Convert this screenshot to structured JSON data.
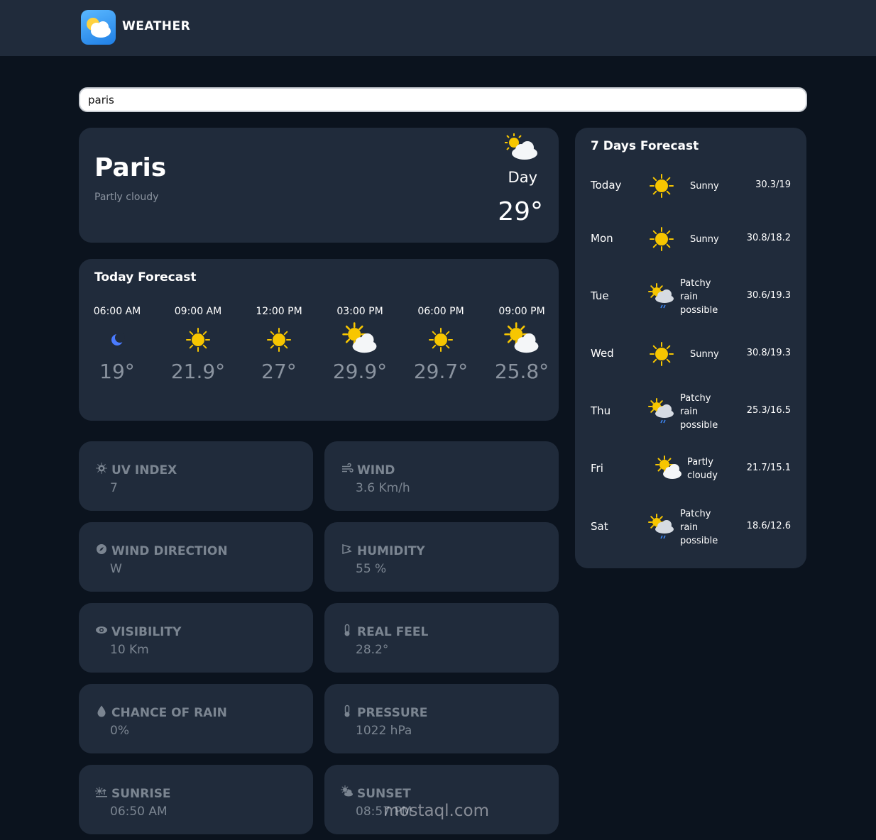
{
  "app": {
    "brand": "WEATHER"
  },
  "search": {
    "value": "paris"
  },
  "current": {
    "city": "Paris",
    "condition": "Partly cloudy",
    "period": "Day",
    "temperature": "29°",
    "icon": "sun-cloud-icon"
  },
  "today_forecast": {
    "title": "Today Forecast",
    "hours": [
      {
        "time": "06:00 AM",
        "temp": "19°",
        "icon": "moon-icon"
      },
      {
        "time": "09:00 AM",
        "temp": "21.9°",
        "icon": "sun-icon"
      },
      {
        "time": "12:00 PM",
        "temp": "27°",
        "icon": "sun-icon"
      },
      {
        "time": "03:00 PM",
        "temp": "29.9°",
        "icon": "sun-cloud-icon"
      },
      {
        "time": "06:00 PM",
        "temp": "29.7°",
        "icon": "sun-icon"
      },
      {
        "time": "09:00 PM",
        "temp": "25.8°",
        "icon": "sun-cloud-icon"
      }
    ]
  },
  "stats": [
    {
      "label": "UV INDEX",
      "value": "7",
      "icon": "sun-gear-icon"
    },
    {
      "label": "WIND",
      "value": "3.6 Km/h",
      "icon": "wind-icon"
    },
    {
      "label": "WIND DIRECTION",
      "value": "W",
      "icon": "compass-icon"
    },
    {
      "label": "HUMIDITY",
      "value": "55 %",
      "icon": "humidity-icon"
    },
    {
      "label": "VISIBILITY",
      "value": "10 Km",
      "icon": "eye-icon"
    },
    {
      "label": "REAL FEEL",
      "value": "28.2°",
      "icon": "thermometer-icon"
    },
    {
      "label": "CHANCE OF RAIN",
      "value": "0%",
      "icon": "droplet-icon"
    },
    {
      "label": "PRESSURE",
      "value": "1022 hPa",
      "icon": "thermometer-icon"
    },
    {
      "label": "SUNRISE",
      "value": "06:50 AM",
      "icon": "sunrise-icon"
    },
    {
      "label": "SUNSET",
      "value": "08:57 PM",
      "icon": "sunset-icon"
    }
  ],
  "weekly": {
    "title": "7 Days Forecast",
    "days": [
      {
        "day": "Today",
        "condition": "Sunny",
        "temps": "30.3/19",
        "icon": "sun-icon"
      },
      {
        "day": "Mon",
        "condition": "Sunny",
        "temps": "30.8/18.2",
        "icon": "sun-icon"
      },
      {
        "day": "Tue",
        "condition": "Patchy rain possible",
        "temps": "30.6/19.3",
        "icon": "sun-cloud-rain-icon"
      },
      {
        "day": "Wed",
        "condition": "Sunny",
        "temps": "30.8/19.3",
        "icon": "sun-icon"
      },
      {
        "day": "Thu",
        "condition": "Patchy rain possible",
        "temps": "25.3/16.5",
        "icon": "sun-cloud-rain-icon"
      },
      {
        "day": "Fri",
        "condition": "Partly cloudy",
        "temps": "21.7/15.1",
        "icon": "sun-cloud-icon"
      },
      {
        "day": "Sat",
        "condition": "Patchy rain possible",
        "temps": "18.6/12.6",
        "icon": "sun-cloud-rain-icon"
      }
    ]
  },
  "watermark": {
    "text": "mostaql.com"
  },
  "colors": {
    "background": "#0b131e",
    "card": "#202b3b",
    "muted": "#8a939f",
    "sun": "#f7c600"
  }
}
